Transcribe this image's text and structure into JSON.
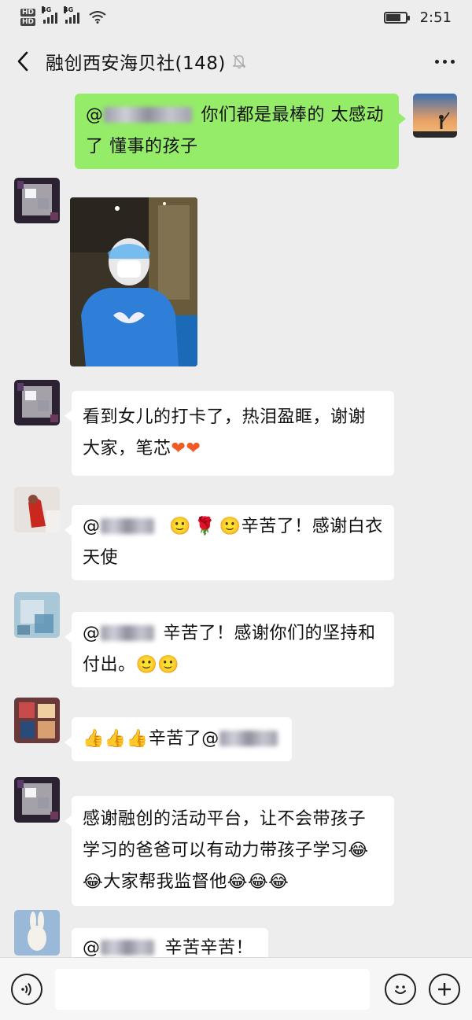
{
  "status_bar": {
    "time": "2:51",
    "network": "4G",
    "battery_level": 0.75
  },
  "chat": {
    "title": "融创西安海贝社(148)",
    "back_icon": "chevron-left-icon",
    "mute_icon": "bell-muted-icon",
    "more_icon": "more-dots-icon"
  },
  "messages": {
    "m1": {
      "mention": "@",
      "text": "你们都是最棒的 太感动了 懂事的孩子"
    },
    "m3": {
      "text": "看到女儿的打卡了，热泪盈眶，谢谢大家，笔芯"
    },
    "m4": {
      "mention": "@",
      "text": "辛苦了！感谢白衣天使"
    },
    "m5": {
      "mention": "@",
      "text_a": "辛苦了！感谢你们的坚持和付出。"
    },
    "m6": {
      "text": "辛苦了@"
    },
    "m7": {
      "text_a": "感谢融创的活动平台，让不会带孩子学习的爸爸可以有动力带孩子学习",
      "text_b": "大家帮我监督他"
    },
    "m8": {
      "mention": "@",
      "text": "辛苦辛苦！"
    }
  },
  "input_bar": {
    "voice_icon": "voice-icon",
    "emoji_icon": "emoji-icon",
    "plus_icon": "plus-icon"
  },
  "colors": {
    "my_bubble": "#95ec69",
    "their_bubble": "#ffffff",
    "background": "#ededed"
  }
}
